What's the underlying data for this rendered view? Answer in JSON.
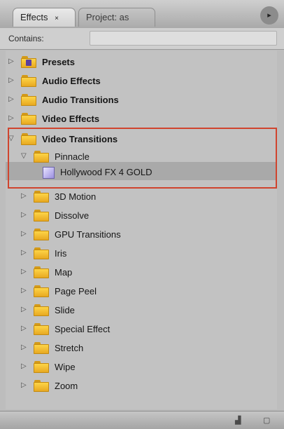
{
  "tabs": {
    "effects": "Effects",
    "effects_close": "×",
    "project": "Project: as"
  },
  "panel_menu_icon": "▸",
  "search": {
    "label": "Contains:",
    "value": ""
  },
  "tree": {
    "presets": "Presets",
    "audio_effects": "Audio Effects",
    "audio_transitions": "Audio Transitions",
    "video_effects": "Video Effects",
    "video_transitions": "Video Transitions",
    "pinnacle": "Pinnacle",
    "hollywood_fx": "Hollywood FX 4 GOLD",
    "motion_3d": "3D Motion",
    "dissolve": "Dissolve",
    "gpu_transitions": "GPU Transitions",
    "iris": "Iris",
    "map": "Map",
    "page_peel": "Page Peel",
    "slide": "Slide",
    "special_effect": "Special Effect",
    "stretch": "Stretch",
    "wipe": "Wipe",
    "zoom": "Zoom"
  },
  "colors": {
    "highlight_border": "#d0442e",
    "folder": "#f2c33a"
  }
}
